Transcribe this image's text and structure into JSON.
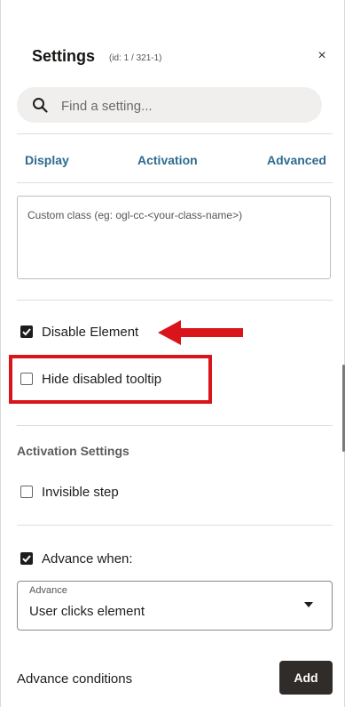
{
  "header": {
    "title": "Settings",
    "id_text": "(id: 1 / 321-1)",
    "close_label": "×"
  },
  "search": {
    "placeholder": "Find a setting..."
  },
  "tabs": [
    {
      "label": "Display"
    },
    {
      "label": "Activation"
    },
    {
      "label": "Advanced"
    }
  ],
  "custom_class": {
    "placeholder": "Custom class (eg: ogl-cc-<your-class-name>)"
  },
  "options": {
    "disable_element": {
      "label": "Disable Element",
      "checked": true
    },
    "hide_disabled_tooltip": {
      "label": "Hide disabled tooltip",
      "checked": false
    }
  },
  "activation": {
    "heading": "Activation Settings",
    "invisible_step": {
      "label": "Invisible step",
      "checked": false
    },
    "advance_when": {
      "label": "Advance when:",
      "checked": true
    },
    "advance_select": {
      "label": "Advance",
      "value": "User clicks element"
    }
  },
  "advance_conditions": {
    "label": "Advance conditions",
    "add_label": "Add"
  },
  "annotations": {
    "highlight_color": "#d9141a"
  }
}
